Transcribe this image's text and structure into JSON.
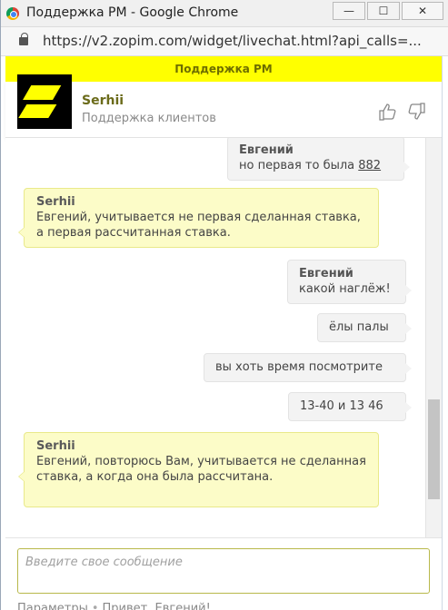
{
  "window": {
    "title": "Поддержка PM - Google Chrome",
    "buttons": {
      "minimize": "—",
      "maximize": "☐",
      "close": "✕"
    }
  },
  "address": {
    "url": "https://v2.zopim.com/widget/livechat.html?api_calls=..."
  },
  "widget": {
    "topbar_title": "Поддержка PM",
    "accent_color": "#ffff00",
    "agent": {
      "name": "Serhii",
      "role": "Поддержка клиентов"
    },
    "messages": [
      {
        "from": "visitor",
        "name": "Евгений",
        "text": "но первая то была ",
        "link": "882"
      },
      {
        "from": "agent",
        "name": "Serhii",
        "text": "Евгений, учитывается не первая сделанная ставка, а первая рассчитанная ставка."
      },
      {
        "from": "visitor",
        "name": "Евгений",
        "text": "какой наглёж!"
      },
      {
        "from": "visitor",
        "name": "",
        "text": "ёлы палы"
      },
      {
        "from": "visitor",
        "name": "",
        "text": "вы хоть время посмотрите"
      },
      {
        "from": "visitor",
        "name": "",
        "text": "13-40 и 13 46"
      },
      {
        "from": "agent",
        "name": "Serhii",
        "text": "Евгений, повторюсь Вам, учитывается не сделанная ставка, а когда она была рассчитана."
      }
    ],
    "input_placeholder": "Введите свое сообщение",
    "footer": {
      "settings": "Параметры",
      "greeting": "Привет, Евгений!"
    }
  }
}
